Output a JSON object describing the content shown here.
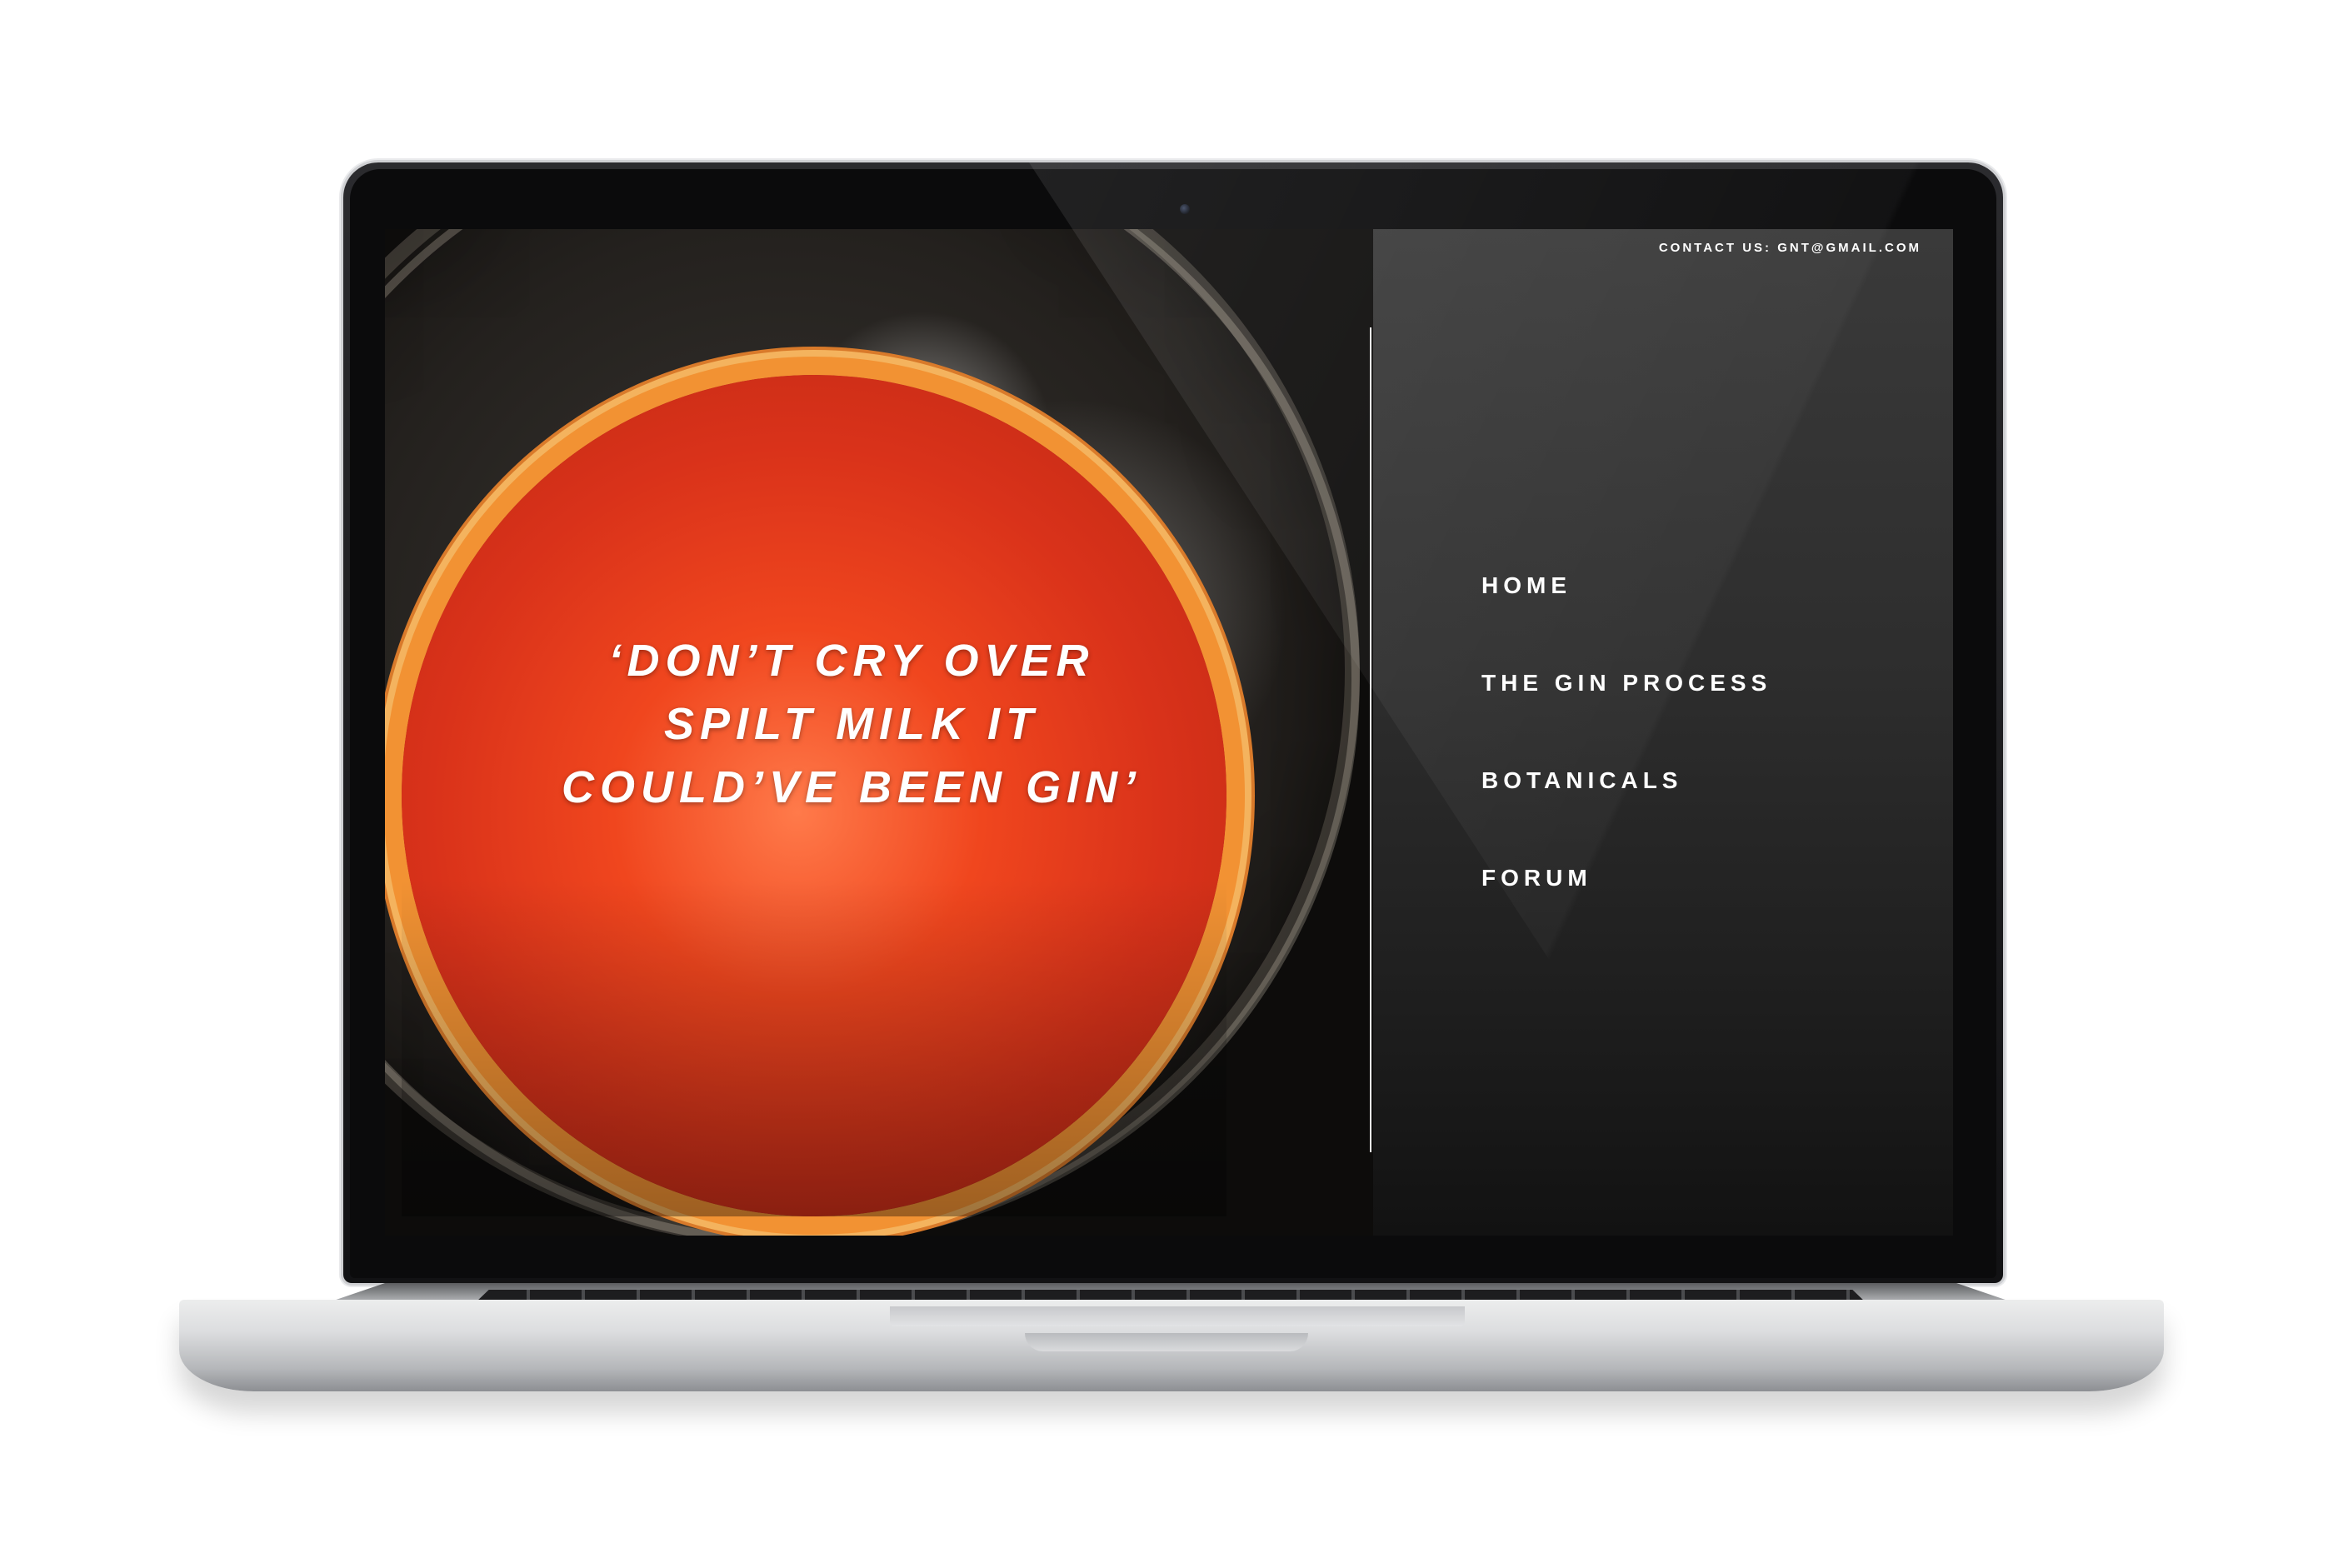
{
  "site": {
    "contact": "CONTACT US: GNT@GMAIL.COM",
    "quote_lines": [
      "‘DON’T CRY OVER",
      "SPILT MILK IT",
      "COULD’VE BEEN GIN’"
    ],
    "nav": [
      {
        "label": "HOME"
      },
      {
        "label": "THE GIN PROCESS"
      },
      {
        "label": "BOTANICALS"
      },
      {
        "label": "FORUM"
      }
    ]
  },
  "colors": {
    "panel_background": "#2d2d2d",
    "text": "#ffffff",
    "fruit": "#e8401c",
    "rind": "#f29233"
  },
  "device": {
    "type": "laptop-mockup",
    "icon": "camera-icon"
  },
  "hero_image": {
    "subject": "grapefruit slice in glass with ice"
  }
}
